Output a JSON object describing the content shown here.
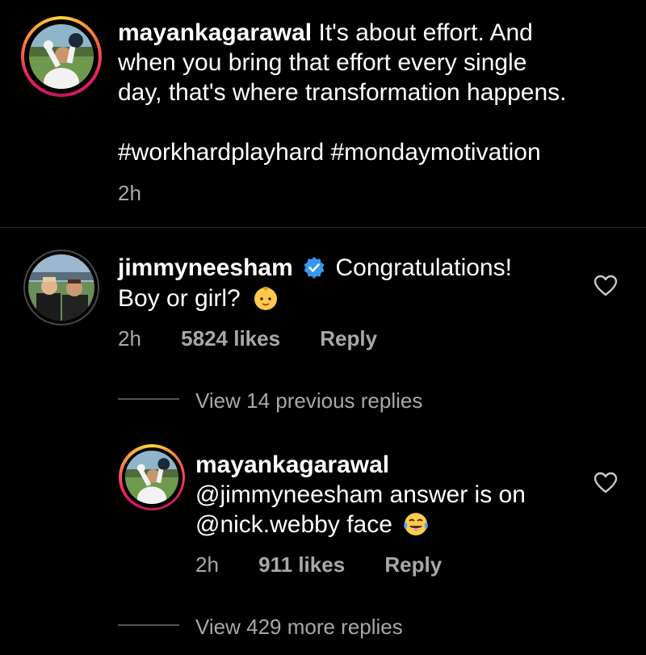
{
  "caption": {
    "username": "mayankagarawal",
    "text_line1": "It's about effort. And",
    "text_line2": "when you bring that effort every single",
    "text_line3": "day, that's where transformation happens.",
    "hashtags": "#workhardplayhard #mondaymotivation",
    "time": "2h"
  },
  "comment": {
    "username": "jimmyneesham",
    "text_line1": "Congratulations!",
    "text_line2": "Boy or girl?",
    "emoji": "baby-emoji",
    "time": "2h",
    "likes": "5824 likes",
    "reply_label": "Reply",
    "view_previous": "View 14 previous replies"
  },
  "reply": {
    "username": "mayankagarawal",
    "text_line1": "@jimmyneesham answer is on",
    "text_line2": "@nick.webby face",
    "emoji": "laughing-crying-emoji",
    "time": "2h",
    "likes": "911 likes",
    "reply_label": "Reply",
    "view_more": "View 429 more replies"
  },
  "icons": {
    "like": "heart-icon",
    "verified": "verified-badge-icon"
  },
  "colors": {
    "background": "#000000",
    "text": "#ffffff",
    "secondary_text": "#a8a8a8",
    "verified": "#3897f0"
  }
}
